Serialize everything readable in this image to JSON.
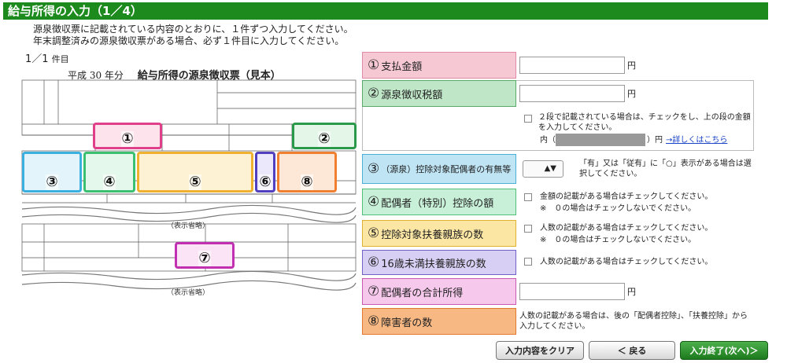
{
  "header": {
    "title": "給与所得の入力（1／4）"
  },
  "intro": [
    "源泉徴収票に記載されている内容のとおりに、１件ずつ入力してください。",
    "年末調整済みの源泉徴収票がある場合、必ず１件目に入力してください。"
  ],
  "counter": {
    "value": "1／1",
    "unit": "件目"
  },
  "form_image": {
    "year": "平成 30 年分",
    "title": "給与所得の源泉徴収票（見本）",
    "omitted": "（表示省略）",
    "marker_labels": [
      "①",
      "②",
      "③",
      "④",
      "⑤",
      "⑥",
      "⑦",
      "⑧"
    ]
  },
  "fields": [
    {
      "num": "①",
      "label": "支払金額",
      "unit": "円",
      "value": ""
    },
    {
      "num": "②",
      "label": "源泉徴収税額",
      "unit": "円",
      "value": "",
      "check_note": "２段で記載されている場合は、チェックをし、上の段の金額を入力してください。",
      "inner_prefix": "内（",
      "inner_suffix": "）円",
      "link": "→詳しくはこちら"
    },
    {
      "num": "③",
      "label": "（源泉）控除対象配偶者の有無等",
      "select_value": "",
      "note": "「有」又は「従有」に「○」表示がある場合は選択してください。"
    },
    {
      "num": "④",
      "label": "配偶者（特別）控除の額",
      "note": "金額の記載がある場合はチェックしてください。",
      "sub": "※　０の場合はチェックしないでください。"
    },
    {
      "num": "⑤",
      "label": "控除対象扶養親族の数",
      "note": "人数の記載がある場合はチェックしてください。",
      "sub": "※　０の場合はチェックしないでください。"
    },
    {
      "num": "⑥",
      "label": "16歳未満扶養親族の数",
      "note": "人数の記載がある場合はチェックしてください。"
    },
    {
      "num": "⑦",
      "label": "配偶者の合計所得",
      "unit": "円",
      "value": ""
    },
    {
      "num": "⑧",
      "label": "障害者の数",
      "note": "人数の記載がある場合は、後の「配偶者控除」、「扶養控除」から入力してください。"
    }
  ],
  "buttons": {
    "clear": "入力内容をクリア",
    "back": "＜ 戻る",
    "next": "入力終了(次へ)＞"
  },
  "colors": {
    "header": "#1c8a1c",
    "f1": "#f6c8d4",
    "f2": "#bfe6c6",
    "f3": "#bfe4f4",
    "f4": "#c8f0d8",
    "f5": "#fbe6a4",
    "f6": "#d8d0f4",
    "f7": "#f6c8ec",
    "f8": "#f8b884"
  }
}
